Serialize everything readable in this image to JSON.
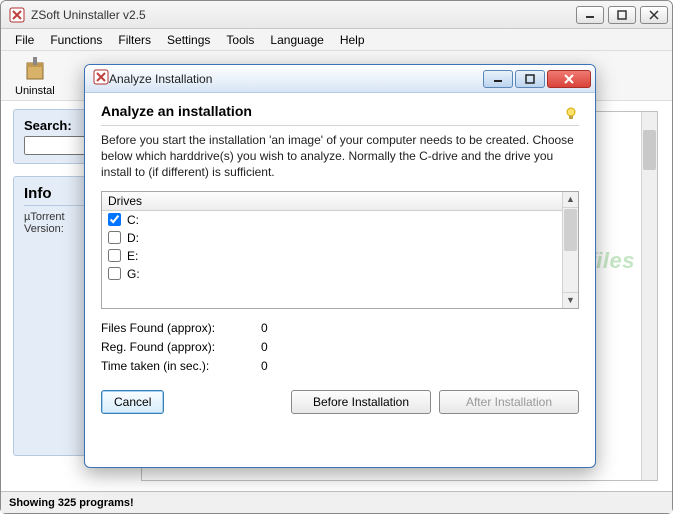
{
  "main_window": {
    "title": "ZSoft Uninstaller v2.5",
    "menubar": [
      "File",
      "Functions",
      "Filters",
      "Settings",
      "Tools",
      "Language",
      "Help"
    ],
    "toolbar": {
      "uninstall_label": "Uninstal"
    },
    "search_label": "Search:",
    "search_value": "",
    "info_header": "Info",
    "info_line1": "µTorrent",
    "info_line2": "Version:",
    "statusbar": "Showing 325 programs!"
  },
  "dialog": {
    "title": "Analyze Installation",
    "heading": "Analyze an installation",
    "description": "Before you start the installation 'an image' of your computer needs to be created. Choose below which harddrive(s) you wish to analyze. Normally the C-drive and the drive you install to (if different) is sufficient.",
    "drives_header": "Drives",
    "drives": [
      {
        "label": "C:",
        "checked": true
      },
      {
        "label": "D:",
        "checked": false
      },
      {
        "label": "E:",
        "checked": false
      },
      {
        "label": "G:",
        "checked": false
      }
    ],
    "stats": {
      "files_label": "Files Found (approx):",
      "files_value": "0",
      "reg_label": "Reg. Found (approx):",
      "reg_value": "0",
      "time_label": "Time taken (in sec.):",
      "time_value": "0"
    },
    "buttons": {
      "cancel": "Cancel",
      "before": "Before Installation",
      "after": "After Installation"
    }
  },
  "watermark": "Snapfiles"
}
